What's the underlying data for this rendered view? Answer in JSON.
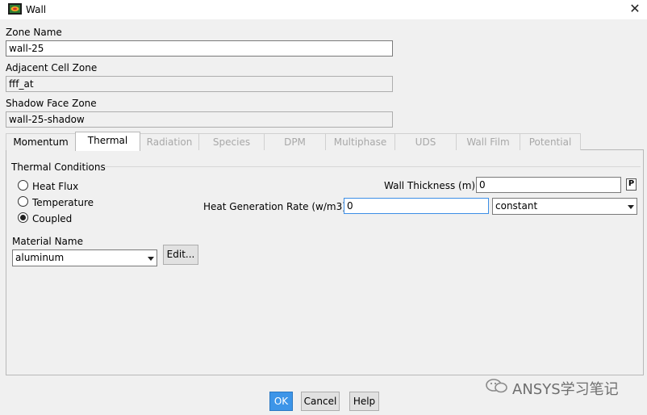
{
  "window": {
    "title": "Wall",
    "close_glyph": "✕"
  },
  "fields": {
    "zone_name": {
      "label": "Zone Name",
      "value": "wall-25"
    },
    "adjacent_cell_zone": {
      "label": "Adjacent Cell Zone",
      "value": "fff_at"
    },
    "shadow_face_zone": {
      "label": "Shadow Face Zone",
      "value": "wall-25-shadow"
    }
  },
  "tabs": [
    {
      "label": "Momentum",
      "state": "enabled"
    },
    {
      "label": "Thermal",
      "state": "active"
    },
    {
      "label": "Radiation",
      "state": "disabled"
    },
    {
      "label": "Species",
      "state": "disabled"
    },
    {
      "label": "DPM",
      "state": "disabled"
    },
    {
      "label": "Multiphase",
      "state": "disabled"
    },
    {
      "label": "UDS",
      "state": "disabled"
    },
    {
      "label": "Wall Film",
      "state": "disabled"
    },
    {
      "label": "Potential",
      "state": "disabled"
    }
  ],
  "thermal": {
    "group_label": "Thermal Conditions",
    "conditions": [
      {
        "label": "Heat Flux",
        "selected": false
      },
      {
        "label": "Temperature",
        "selected": false
      },
      {
        "label": "Coupled",
        "selected": true
      }
    ],
    "material": {
      "label": "Material Name",
      "value": "aluminum",
      "edit_label": "Edit..."
    },
    "wall_thickness": {
      "label": "Wall Thickness (m)",
      "value": "0",
      "param_label": "P"
    },
    "heat_generation": {
      "label": "Heat Generation Rate (w/m3)",
      "value": "0",
      "method": "constant"
    }
  },
  "buttons": {
    "ok": "OK",
    "cancel": "Cancel",
    "help": "Help"
  },
  "watermark": {
    "text": "ANSYS学习笔记"
  },
  "colors": {
    "accent": "#3d95e8",
    "focus_border": "#3c8ee6"
  }
}
